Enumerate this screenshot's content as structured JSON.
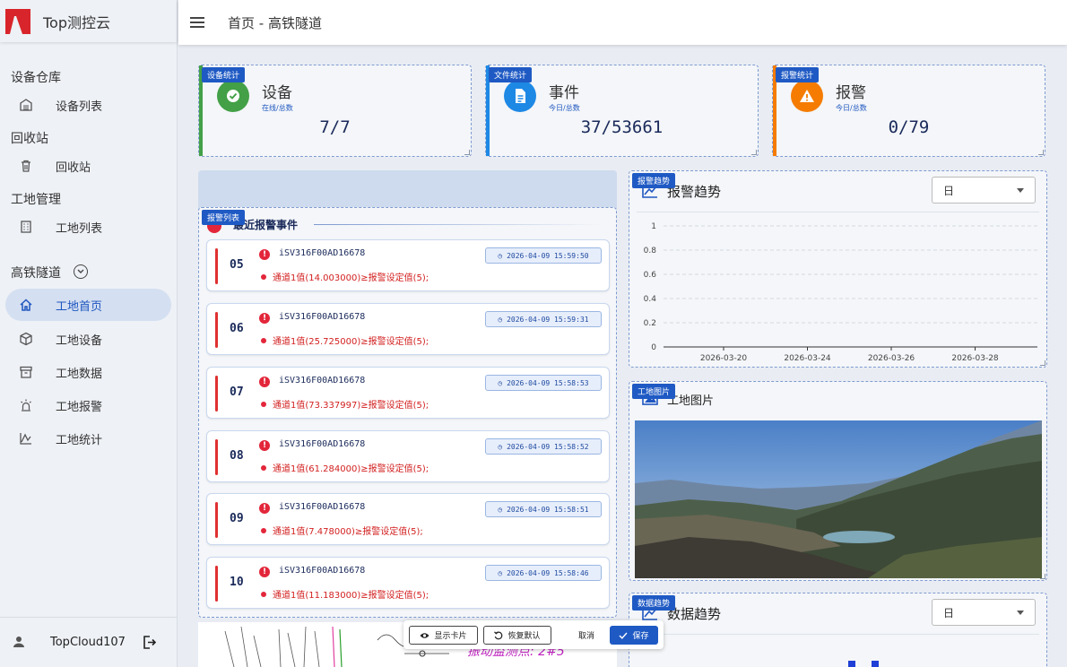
{
  "app": {
    "name": "Top测控云"
  },
  "topbar": {
    "breadcrumb": "首页 - 高铁隧道"
  },
  "sidebar": {
    "groups": [
      {
        "title": "设备仓库",
        "items": [
          {
            "label": "设备列表",
            "icon": "warehouse-icon"
          }
        ]
      },
      {
        "title": "回收站",
        "items": [
          {
            "label": "回收站",
            "icon": "trash-icon"
          }
        ]
      },
      {
        "title": "工地管理",
        "items": [
          {
            "label": "工地列表",
            "icon": "building-icon"
          }
        ]
      },
      {
        "title": "高铁隧道",
        "items": [
          {
            "label": "工地首页",
            "icon": "home-icon",
            "active": true
          },
          {
            "label": "工地设备",
            "icon": "cube-icon"
          },
          {
            "label": "工地数据",
            "icon": "archive-icon"
          },
          {
            "label": "工地报警",
            "icon": "alarm-light-icon"
          },
          {
            "label": "工地统计",
            "icon": "chart-icon"
          }
        ]
      }
    ],
    "user": {
      "name": "TopCloud107"
    }
  },
  "stats": [
    {
      "tag": "设备统计",
      "title": "设备",
      "sub": "在线/总数",
      "value": "7/7",
      "color": "#43a047",
      "icon": "check-icon"
    },
    {
      "tag": "文件统计",
      "title": "事件",
      "sub": "今日/总数",
      "value": "37/53661",
      "color": "#1e88e5",
      "icon": "document-icon"
    },
    {
      "tag": "报警统计",
      "title": "报警",
      "sub": "今日/总数",
      "value": "0/79",
      "color": "#f57c00",
      "icon": "warning-icon"
    }
  ],
  "alarm_list": {
    "tag": "报警列表",
    "title": "最近报警事件",
    "items": [
      {
        "num": "05",
        "device": "iSV316F00AD16678",
        "time": "2026-04-09 15:59:50",
        "msg": "通道1值(14.003000)≥报警设定值(5);"
      },
      {
        "num": "06",
        "device": "iSV316F00AD16678",
        "time": "2026-04-09 15:59:31",
        "msg": "通道1值(25.725000)≥报警设定值(5);"
      },
      {
        "num": "07",
        "device": "iSV316F00AD16678",
        "time": "2026-04-09 15:58:53",
        "msg": "通道1值(73.337997)≥报警设定值(5);"
      },
      {
        "num": "08",
        "device": "iSV316F00AD16678",
        "time": "2026-04-09 15:58:52",
        "msg": "通道1值(61.284000)≥报警设定值(5);"
      },
      {
        "num": "09",
        "device": "iSV316F00AD16678",
        "time": "2026-04-09 15:58:51",
        "msg": "通道1值(7.478000)≥报警设定值(5);"
      },
      {
        "num": "10",
        "device": "iSV316F00AD16678",
        "time": "2026-04-09 15:58:46",
        "msg": "通道1值(11.183000)≥报警设定值(5);"
      }
    ]
  },
  "alarm_trend": {
    "tag": "报警趋势",
    "title": "报警趋势",
    "select_value": "日"
  },
  "chart_data": {
    "type": "line",
    "title": "报警趋势",
    "x": [
      "2026-03-20",
      "2026-03-24",
      "2026-03-26",
      "2026-03-28"
    ],
    "yticks": [
      "1",
      "0.8",
      "0.6",
      "0.4",
      "0.2",
      "0"
    ],
    "ylim": [
      0,
      1
    ],
    "series": [],
    "grid": true
  },
  "site_image": {
    "tag": "工地图片",
    "title": "工地图片"
  },
  "data_trend": {
    "tag": "数据趋势",
    "title": "数据趋势",
    "select_value": "日"
  },
  "map_preview": {
    "text": "振动监测点: 2#5"
  },
  "toolbar": {
    "show_cards": "显示卡片",
    "restore": "恢复默认",
    "cancel": "取消",
    "save": "保存"
  },
  "colors": {
    "primary": "#1f5ac4",
    "alarm": "#e3263a"
  }
}
